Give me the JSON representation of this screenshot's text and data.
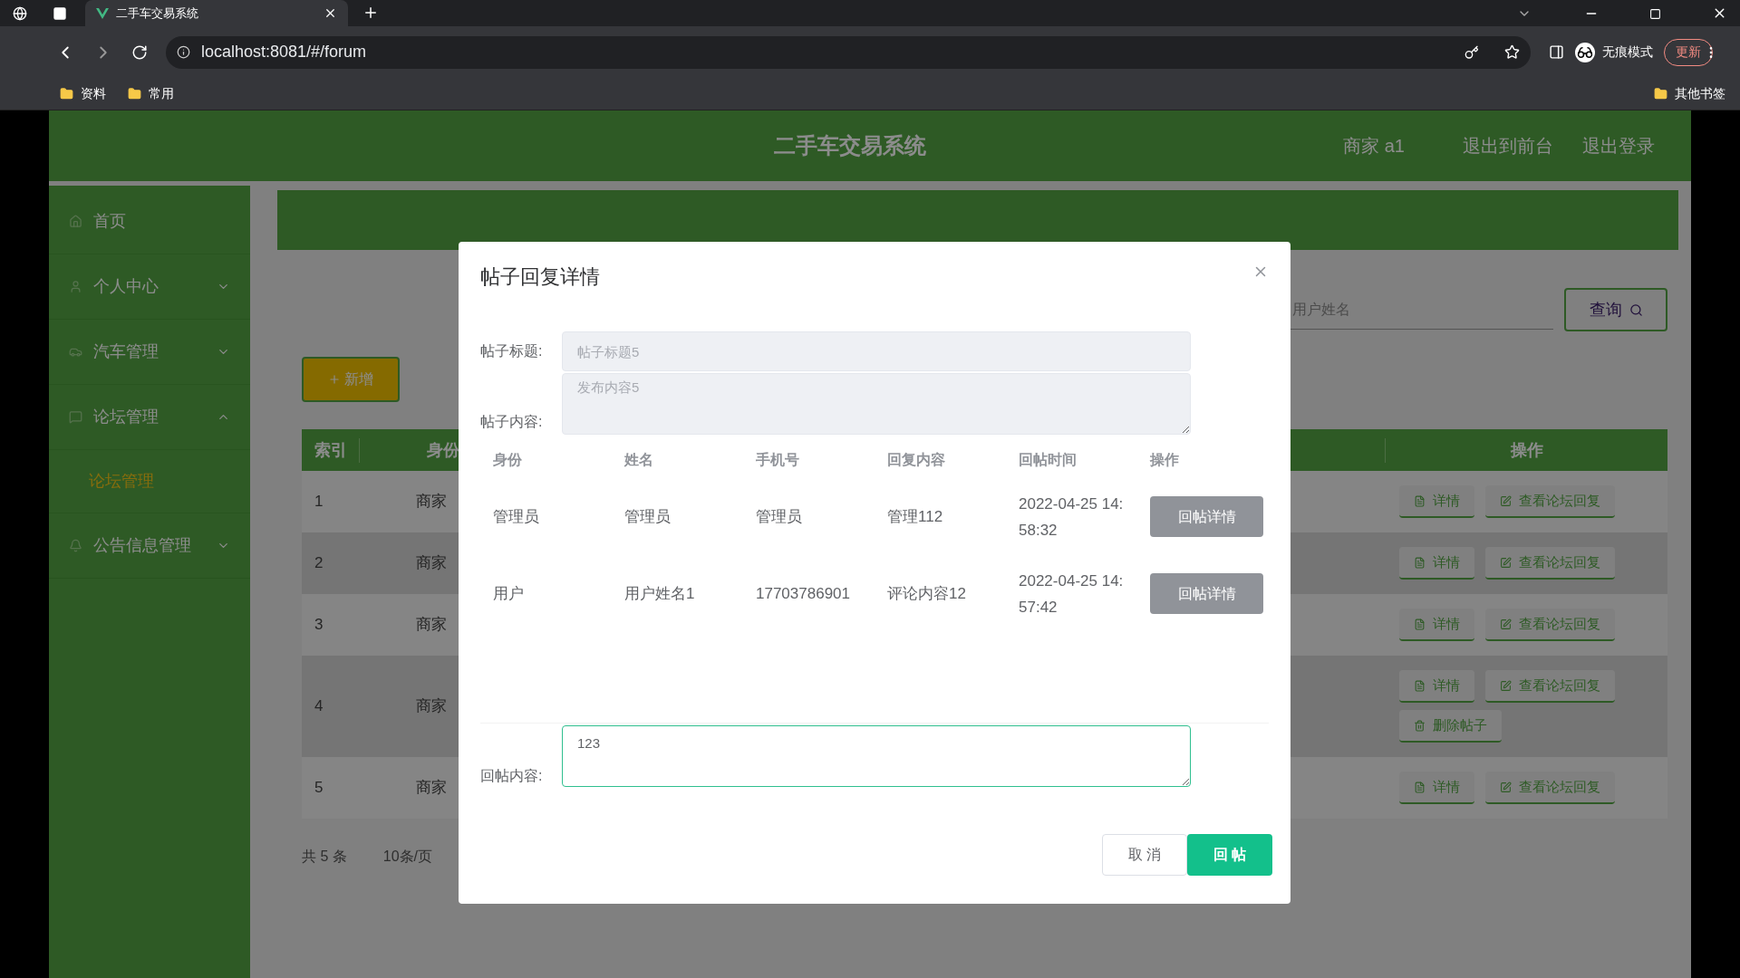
{
  "browser": {
    "tabs": [
      {
        "title": "二手车交易系统",
        "selected": true
      }
    ],
    "address": "localhost:8081/#/forum",
    "incognito_label": "无痕模式",
    "update_button": "更新",
    "bookmarks": [
      "资料",
      "常用"
    ],
    "other_bookmarks": "其他书签"
  },
  "header": {
    "title": "二手车交易系统",
    "user": "商家 a1",
    "links": [
      "退出到前台",
      "退出登录"
    ]
  },
  "sidebar": {
    "items": [
      {
        "label": "首页",
        "kind": "link"
      },
      {
        "label": "个人中心",
        "kind": "menu",
        "expanded": false
      },
      {
        "label": "汽车管理",
        "kind": "menu",
        "expanded": false
      },
      {
        "label": "论坛管理",
        "kind": "menu",
        "expanded": true,
        "children": [
          {
            "label": "论坛管理",
            "selected": true
          }
        ]
      },
      {
        "label": "公告信息管理",
        "kind": "menu",
        "expanded": false
      }
    ]
  },
  "main": {
    "search": {
      "placeholder": "用户姓名"
    },
    "search_button": "查询",
    "add_button": "新增",
    "table": {
      "columns": [
        "索引",
        "身份",
        "操作"
      ],
      "rows": [
        {
          "index": "1",
          "role": "商家",
          "actions": [
            {
              "kind": "detail",
              "label": "详情"
            },
            {
              "kind": "replies",
              "label": "查看论坛回复"
            }
          ]
        },
        {
          "index": "2",
          "role": "商家",
          "actions": [
            {
              "kind": "detail",
              "label": "详情"
            },
            {
              "kind": "replies",
              "label": "查看论坛回复"
            }
          ]
        },
        {
          "index": "3",
          "role": "商家",
          "actions": [
            {
              "kind": "detail",
              "label": "详情"
            },
            {
              "kind": "replies",
              "label": "查看论坛回复"
            }
          ]
        },
        {
          "index": "4",
          "role": "商家",
          "actions": [
            {
              "kind": "detail",
              "label": "详情"
            },
            {
              "kind": "replies",
              "label": "查看论坛回复"
            },
            {
              "kind": "delete",
              "label": "删除帖子"
            }
          ]
        },
        {
          "index": "5",
          "role": "商家",
          "actions": [
            {
              "kind": "detail",
              "label": "详情"
            },
            {
              "kind": "replies",
              "label": "查看论坛回复"
            }
          ]
        }
      ]
    },
    "pagination": {
      "total": "共 5 条",
      "page_size": "10条/页"
    }
  },
  "modal": {
    "title": "帖子回复详情",
    "post_title": {
      "label": "帖子标题:",
      "placeholder": "帖子标题5",
      "disabled": true
    },
    "post_content": {
      "label": "帖子内容:",
      "placeholder": "发布内容5",
      "disabled": true
    },
    "replies": {
      "columns": [
        "身份",
        "姓名",
        "手机号",
        "回复内容",
        "回帖时间",
        "操作"
      ],
      "rows": [
        {
          "role": "管理员",
          "name": "管理员",
          "phone": "管理员",
          "content": "管理112",
          "time": "2022-04-25 14:58:32",
          "button": "回帖详情"
        },
        {
          "role": "用户",
          "name": "用户姓名1",
          "phone": "17703786901",
          "content": "评论内容12",
          "time": "2022-04-25 14:57:42",
          "button": "回帖详情"
        }
      ]
    },
    "reply_field": {
      "label": "回帖内容:",
      "value": "123"
    },
    "cancel_button": "取 消",
    "submit_button": "回 帖"
  }
}
